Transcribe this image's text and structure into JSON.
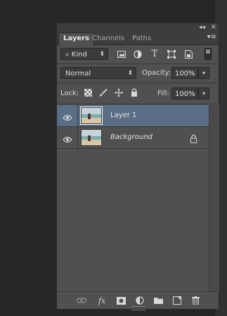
{
  "panel": {
    "titlebar": {
      "collapse_glyph": "◂◂",
      "close_glyph": "✕"
    },
    "tabs": [
      {
        "label": "Layers",
        "active": true
      },
      {
        "label": "Channels",
        "active": false
      },
      {
        "label": "Paths",
        "active": false
      }
    ],
    "menu_glyph": "▾≡"
  },
  "filter": {
    "kind_label": "Kind",
    "icons": [
      "pixel-filter-icon",
      "adjustment-filter-icon",
      "type-filter-icon",
      "shape-filter-icon",
      "smart-object-filter-icon"
    ]
  },
  "blend": {
    "mode": "Normal",
    "opacity_label": "Opacity:",
    "opacity_value": "100%"
  },
  "lock": {
    "label": "Lock:",
    "fill_label": "Fill:",
    "fill_value": "100%"
  },
  "layers": [
    {
      "name": "Layer 1",
      "selected": true,
      "italic": false,
      "locked": false
    },
    {
      "name": "Background",
      "selected": false,
      "italic": true,
      "locked": true
    }
  ],
  "footer": {
    "icons": [
      "link-layers-icon",
      "fx-icon",
      "add-mask-icon",
      "adjustment-layer-icon",
      "new-group-icon",
      "new-layer-icon",
      "delete-layer-icon"
    ],
    "fx_label": "fx"
  },
  "colors": {
    "panel_bg": "#505050",
    "selection": "#5a6e85",
    "app_bg": "#262626"
  }
}
